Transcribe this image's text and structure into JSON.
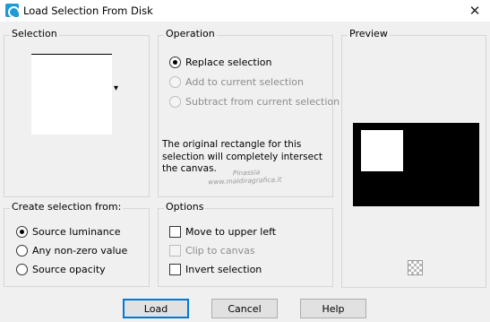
{
  "window": {
    "title": "Load Selection From Disk",
    "close_glyph": "✕"
  },
  "selection": {
    "legend": "Selection",
    "dropdown_arrow": "▾"
  },
  "operation": {
    "legend": "Operation",
    "options": [
      {
        "label": "Replace selection",
        "checked": true,
        "enabled": true
      },
      {
        "label": "Add to current selection",
        "checked": false,
        "enabled": false
      },
      {
        "label": "Subtract from current selection",
        "checked": false,
        "enabled": false
      }
    ],
    "message": "The original rectangle for this selection will completely intersect the canvas."
  },
  "preview": {
    "legend": "Preview"
  },
  "create_from": {
    "legend": "Create selection from:",
    "options": [
      {
        "label": "Source luminance",
        "checked": true
      },
      {
        "label": "Any non-zero value",
        "checked": false
      },
      {
        "label": "Source opacity",
        "checked": false
      }
    ]
  },
  "options": {
    "legend": "Options",
    "items": [
      {
        "label": "Move to upper left",
        "checked": false,
        "enabled": true
      },
      {
        "label": "Clip to canvas",
        "checked": false,
        "enabled": false
      },
      {
        "label": "Invert selection",
        "checked": false,
        "enabled": true
      }
    ]
  },
  "watermark": {
    "line1": "Pinassia",
    "line2": "www.maldiragrafica.it"
  },
  "buttons": {
    "load": "Load",
    "cancel": "Cancel",
    "help": "Help"
  },
  "colors": {
    "accent": "#0078d7",
    "preview_bg": "#000000",
    "preview_shape": "#ffffff"
  }
}
